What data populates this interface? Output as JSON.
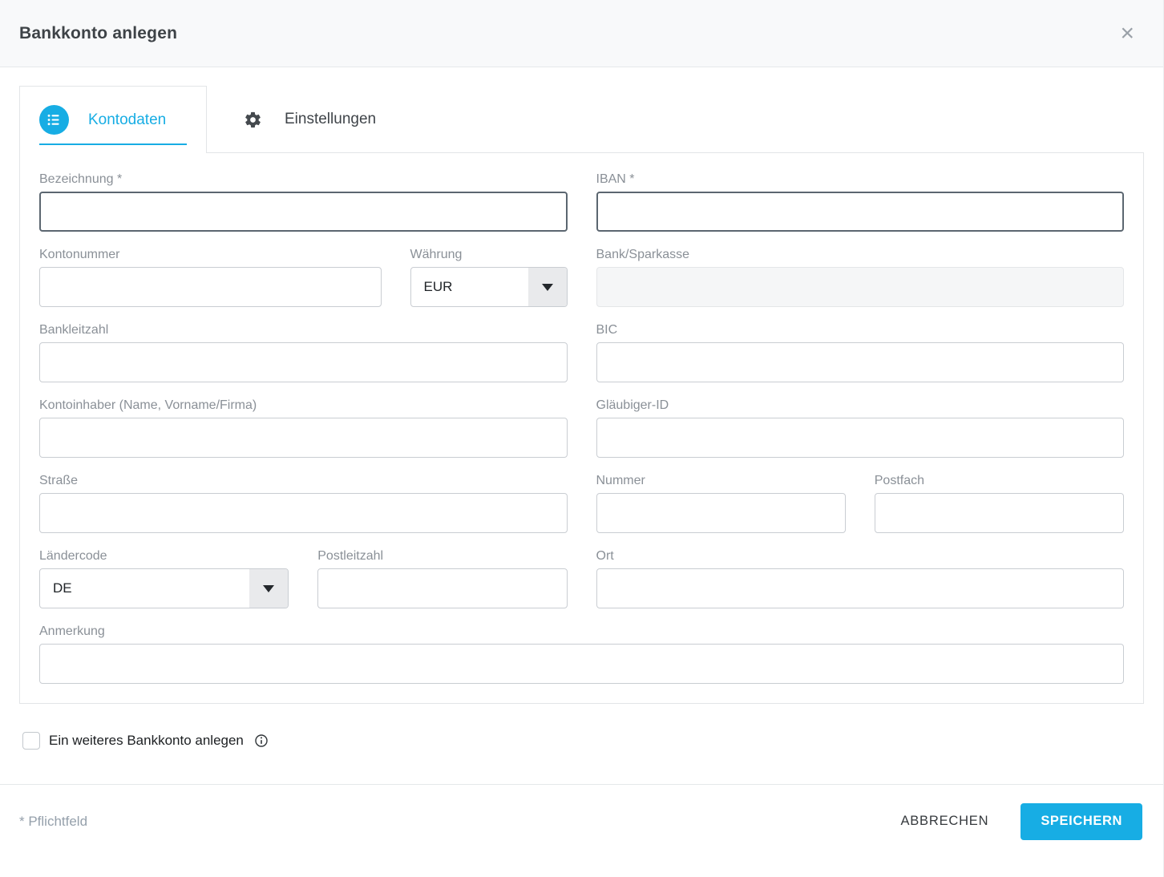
{
  "dialog": {
    "title": "Bankkonto anlegen",
    "close_glyph": "×"
  },
  "tabs": [
    {
      "id": "kontodaten",
      "label": "Kontodaten",
      "icon": "list-icon",
      "active": true
    },
    {
      "id": "einstellungen",
      "label": "Einstellungen",
      "icon": "gear-icon",
      "active": false
    }
  ],
  "form": {
    "fields": {
      "bezeichnung": {
        "label": "Bezeichnung *",
        "value": "",
        "required": true
      },
      "iban": {
        "label": "IBAN *",
        "value": "",
        "required": true
      },
      "kontonummer": {
        "label": "Kontonummer",
        "value": ""
      },
      "waehrung": {
        "label": "Währung",
        "value": "EUR",
        "type": "select"
      },
      "bank_sparkasse": {
        "label": "Bank/Sparkasse",
        "value": "",
        "disabled": true
      },
      "bankleitzahl": {
        "label": "Bankleitzahl",
        "value": ""
      },
      "bic": {
        "label": "BIC",
        "value": ""
      },
      "kontoinhaber": {
        "label": "Kontoinhaber (Name, Vorname/Firma)",
        "value": ""
      },
      "glaeubiger_id": {
        "label": "Gläubiger-ID",
        "value": ""
      },
      "strasse": {
        "label": "Straße",
        "value": ""
      },
      "nummer": {
        "label": "Nummer",
        "value": ""
      },
      "postfach": {
        "label": "Postfach",
        "value": ""
      },
      "laendercode": {
        "label": "Ländercode",
        "value": "DE",
        "type": "select"
      },
      "postleitzahl": {
        "label": "Postleitzahl",
        "value": ""
      },
      "ort": {
        "label": "Ort",
        "value": ""
      },
      "anmerkung": {
        "label": "Anmerkung",
        "value": ""
      }
    }
  },
  "checkbox": {
    "label": "Ein weiteres Bankkonto anlegen",
    "checked": false,
    "info_icon": "info-circle"
  },
  "footer": {
    "required_hint": "* Pflichtfeld",
    "cancel_label": "ABBRECHEN",
    "save_label": "SPEICHERN"
  },
  "colors": {
    "accent": "#17ade4",
    "required_border": "#5b6670",
    "input_border": "#c9cdd2",
    "label_gray": "#8a9097",
    "header_bg": "#f8f9fa"
  }
}
